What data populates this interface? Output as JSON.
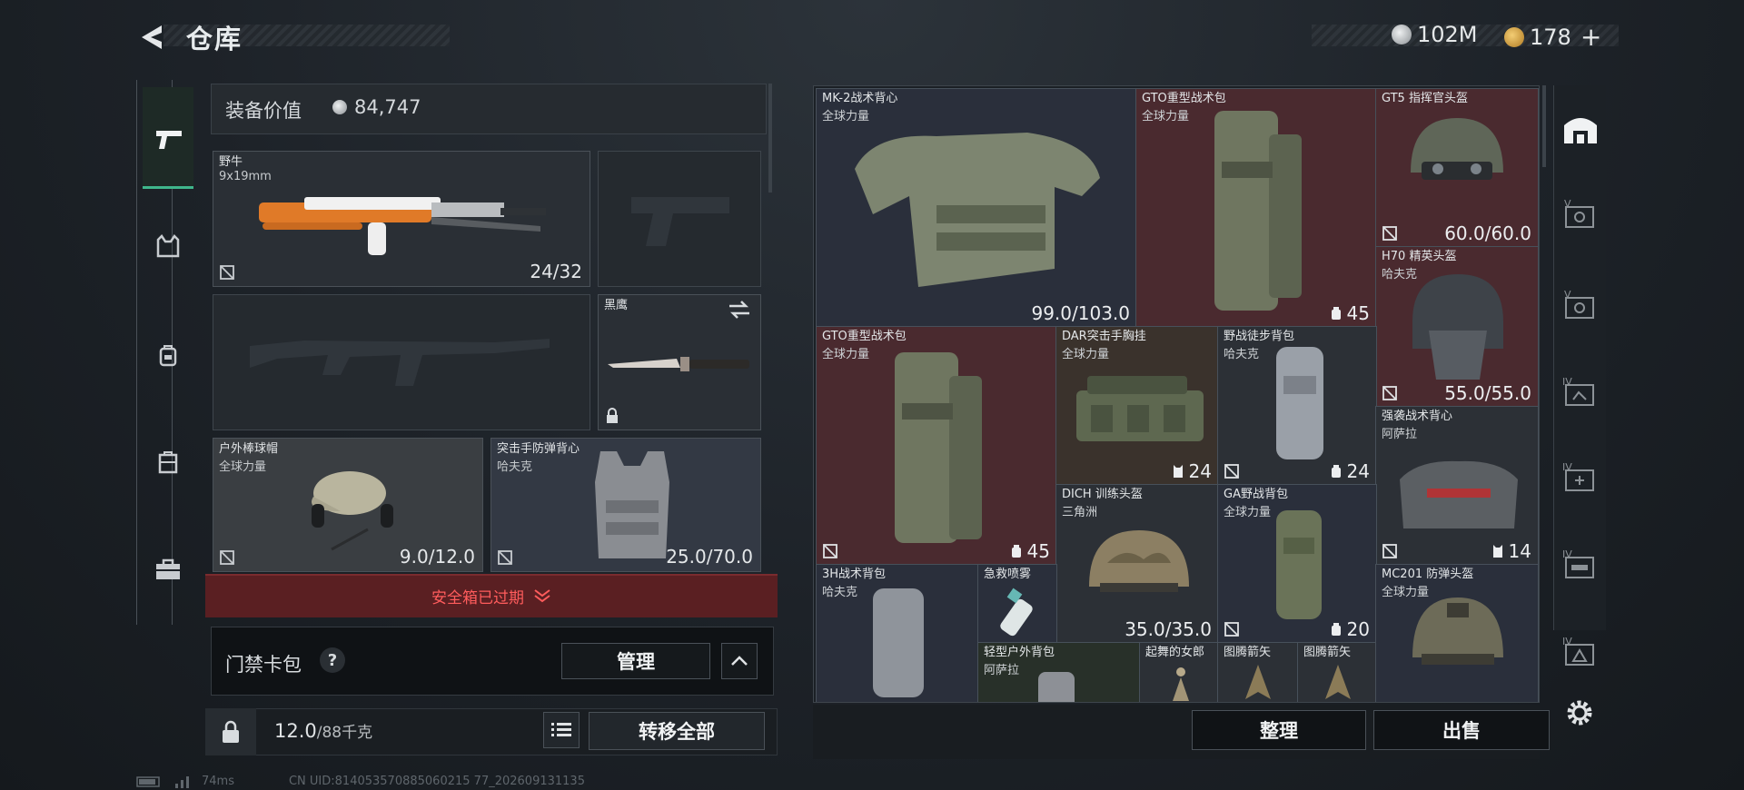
{
  "header": {
    "title": "仓库",
    "currencies": [
      {
        "icon": "coin-silver-icon",
        "value": "102M",
        "color": "#c6c9cc"
      },
      {
        "icon": "coin-gold-icon",
        "value": "178",
        "color": "#d9a441"
      }
    ],
    "add_symbol": "+"
  },
  "left_rail": {
    "items": [
      {
        "icon": "pistol-icon",
        "active": true
      },
      {
        "icon": "armor-vest-icon"
      },
      {
        "icon": "backpack-icon"
      },
      {
        "icon": "chest-rig-icon"
      },
      {
        "icon": "briefcase-icon"
      }
    ]
  },
  "equipment": {
    "value_label": "装备价值",
    "value": "84,747",
    "primary_weapon": {
      "name": "野牛",
      "ammo": "9x19mm",
      "count": "24/32"
    },
    "melee": {
      "name": "黑鹰"
    },
    "helmet": {
      "name": "户外棒球帽",
      "faction": "全球力量",
      "durability": "9.0/12.0"
    },
    "armor": {
      "name": "突击手防弹背心",
      "faction": "哈夫克",
      "durability": "25.0/70.0"
    },
    "safe_box_text": "安全箱已过期",
    "card_bag_label": "门禁卡包",
    "help_symbol": "?",
    "manage_label": "管理",
    "weight": "12.0",
    "weight_max": "/88千克",
    "transfer_all_label": "转移全部"
  },
  "storage": {
    "items": [
      {
        "name": "MK-2战术背心",
        "sub": "全球力量",
        "value": "99.0/103.0"
      },
      {
        "name": "GTO重型战术包",
        "sub": "全球力量",
        "value": "45"
      },
      {
        "name": "GT5 指挥官头盔",
        "sub": "",
        "value": "60.0/60.0"
      },
      {
        "name": "H70 精英头盔",
        "sub": "哈夫克",
        "value": "55.0/55.0"
      },
      {
        "name": "GTO重型战术包",
        "sub": "全球力量",
        "value": "45"
      },
      {
        "name": "DAR突击手胸挂",
        "sub": "全球力量",
        "value": "24"
      },
      {
        "name": "野战徒步背包",
        "sub": "哈夫克",
        "value": "24"
      },
      {
        "name": "强袭战术背心",
        "sub": "阿萨拉",
        "value": "14"
      },
      {
        "name": "DICH 训练头盔",
        "sub": "三角洲",
        "value": "35.0/35.0"
      },
      {
        "name": "GA野战背包",
        "sub": "全球力量",
        "value": "20"
      },
      {
        "name": "3H战术背包",
        "sub": "哈夫克",
        "value": ""
      },
      {
        "name": "急救喷雾",
        "sub": "",
        "value": ""
      },
      {
        "name": "MC201 防弹头盔",
        "sub": "全球力量",
        "value": ""
      },
      {
        "name": "轻型户外背包",
        "sub": "阿萨拉",
        "value": ""
      },
      {
        "name": "起舞的女郎",
        "sub": "",
        "value": ""
      },
      {
        "name": "图腾箭矢",
        "sub": "",
        "value": ""
      },
      {
        "name": "图腾箭矢",
        "sub": "",
        "value": ""
      }
    ],
    "sort_label": "整理",
    "sell_label": "出售"
  },
  "right_rail": {
    "items": [
      {
        "icon": "warehouse-home-icon"
      },
      {
        "icon": "storage-tab-v-icon",
        "label": "V"
      },
      {
        "icon": "storage-tab-v-icon",
        "label": "V"
      },
      {
        "icon": "storage-tab-iv-icon",
        "label": "IV"
      },
      {
        "icon": "storage-tab-iv-icon",
        "label": "IV"
      },
      {
        "icon": "storage-tab-iv-icon",
        "label": "IV"
      },
      {
        "icon": "storage-tab-iv-icon",
        "label": "IV"
      }
    ],
    "settings_icon": "gear-icon"
  },
  "footer": {
    "ping": "74ms",
    "uid": "CN UID:814053570885060215 77_202609131135"
  }
}
